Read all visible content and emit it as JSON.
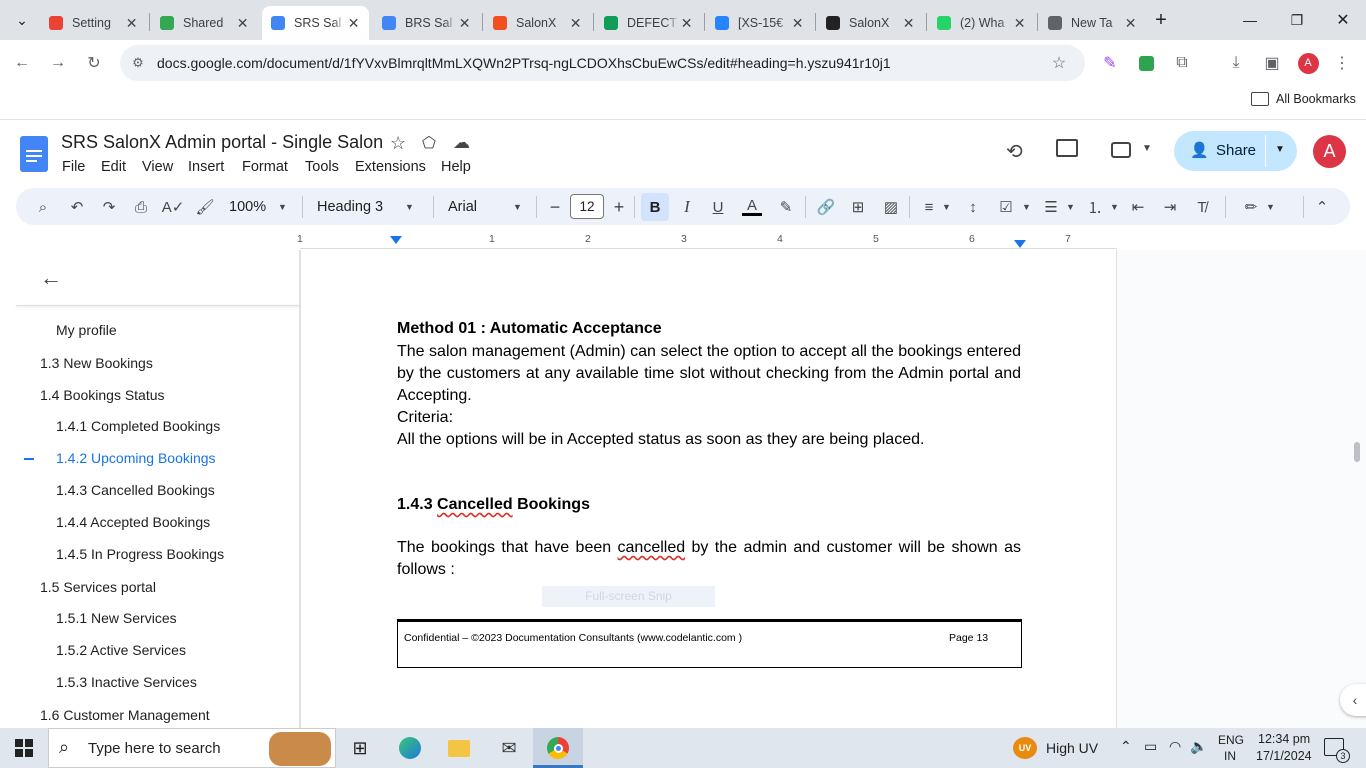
{
  "browser": {
    "tabs": [
      {
        "label": "Setting",
        "icon": "gmail-icon",
        "color": "#ea4335"
      },
      {
        "label": "Shared",
        "icon": "drive-icon",
        "color": "#34a853"
      },
      {
        "label": "SRS Sal",
        "icon": "docs-icon",
        "color": "#4285f4",
        "active": true
      },
      {
        "label": "BRS Sal",
        "icon": "docs-icon",
        "color": "#4285f4"
      },
      {
        "label": "SalonX",
        "icon": "figma-icon",
        "color": "#f24e1e"
      },
      {
        "label": "DEFECT",
        "icon": "sheets-icon",
        "color": "#0f9d58"
      },
      {
        "label": "[XS-15€",
        "icon": "jira-icon",
        "color": "#2684ff"
      },
      {
        "label": "SalonX",
        "icon": "angular-icon",
        "color": "#222222"
      },
      {
        "label": "(2) Wha",
        "icon": "whatsapp-icon",
        "color": "#25d366"
      },
      {
        "label": "New Ta",
        "icon": "chrome-icon",
        "color": "#5f6368"
      }
    ],
    "url": "docs.google.com/document/d/1fYVxvBlmrqltMmLXQWn2PTrsq-ngLCDOXhsCbuEwCSs/edit#heading=h.yszu941r10j1",
    "bookmarks_label": "All Bookmarks",
    "profile_initial": "A"
  },
  "doc": {
    "title": "SRS SalonX Admin portal - Single Salon",
    "menu": [
      "File",
      "Edit",
      "View",
      "Insert",
      "Format",
      "Tools",
      "Extensions",
      "Help"
    ],
    "share_label": "Share",
    "avatar_initial": "A"
  },
  "toolbar": {
    "zoom": "100%",
    "style": "Heading 3",
    "font": "Arial",
    "font_size": "12"
  },
  "ruler": [
    "1",
    "1",
    "2",
    "3",
    "4",
    "5",
    "6",
    "7"
  ],
  "outline": {
    "items": [
      {
        "label": "My profile",
        "level": 2
      },
      {
        "label": "1.3 New Bookings",
        "level": 1
      },
      {
        "label": "1.4 Bookings Status",
        "level": 1
      },
      {
        "label": "1.4.1 Completed Bookings",
        "level": 2
      },
      {
        "label": "1.4.2 Upcoming Bookings",
        "level": 2,
        "active": true
      },
      {
        "label": "1.4.3 Cancelled Bookings",
        "level": 2
      },
      {
        "label": "1.4.4 Accepted Bookings",
        "level": 2
      },
      {
        "label": "1.4.5 In Progress Bookings",
        "level": 2
      },
      {
        "label": "1.5 Services portal",
        "level": 1
      },
      {
        "label": "1.5.1 New Services",
        "level": 2
      },
      {
        "label": "1.5.2 Active Services",
        "level": 2
      },
      {
        "label": "1.5.3 Inactive Services",
        "level": 2
      },
      {
        "label": "1.6 Customer Management",
        "level": 1
      }
    ]
  },
  "content": {
    "method_heading": "Method 01 : Automatic Acceptance",
    "para1_line1": "The salon management (Admin) can select the option to accept all the bookings entered",
    "para1_line2": "by the customers at any available time slot without checking from the Admin portal  and",
    "para1_line3": "Accepting.",
    "criteria": "Criteria:",
    "criteria_text": "All the options will be in Accepted status as soon as they are being placed.",
    "section_heading_num": "1.4.3 ",
    "section_heading_word": "Cancelled",
    "section_heading_rest": " Bookings",
    "para2_a": "The bookings that have been ",
    "para2_word": "cancelled",
    "para2_b": " by the admin and customer will be shown as",
    "para2_line2": "follows :",
    "snip_text": "Full-screen Snip",
    "footer_text": "Confidential – ©2023 Documentation Consultants (www.codelantic.com )",
    "footer_page": "Page  13"
  },
  "taskbar": {
    "search_placeholder": "Type here to search",
    "weather": "High UV",
    "weather_badge": "UV",
    "lang1": "ENG",
    "lang2": "IN",
    "time": "12:34 pm",
    "date": "17/1/2024",
    "notif_count": "3"
  }
}
